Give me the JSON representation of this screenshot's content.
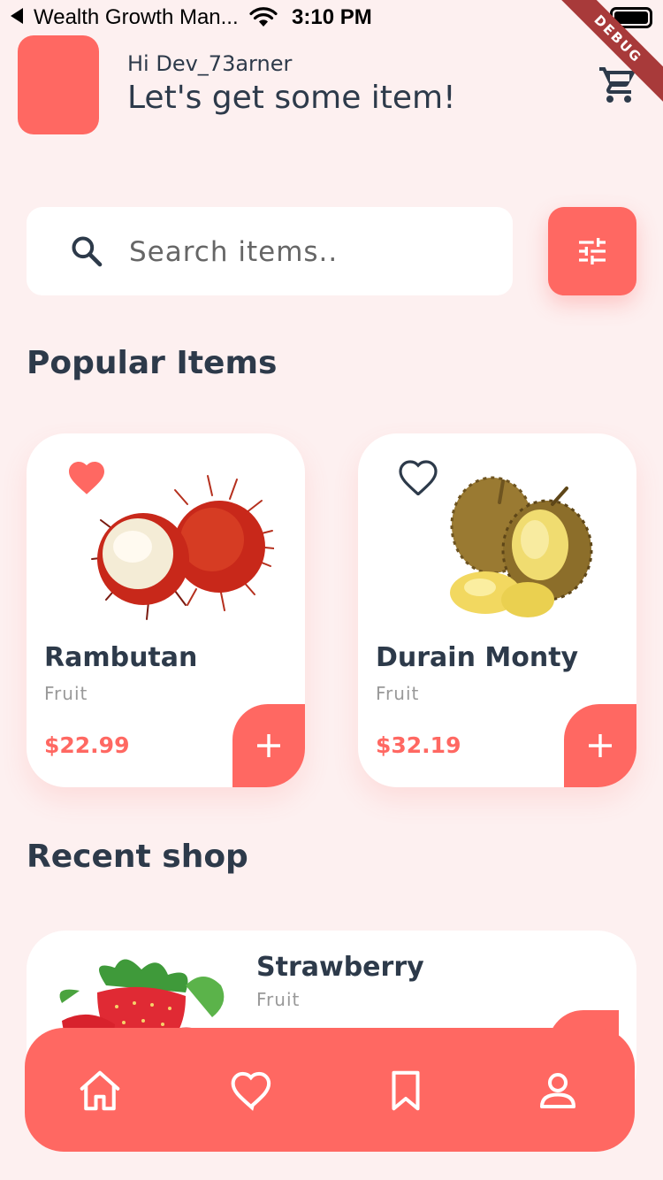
{
  "status_bar": {
    "app_name": "Wealth Growth Man...",
    "time": "3:10 PM"
  },
  "debug_ribbon": "DEBUG",
  "header": {
    "greeting": "Hi Dev_73arner",
    "headline": "Let's get some item!",
    "cart_icon": "cart-icon"
  },
  "search": {
    "placeholder": "Search items..",
    "value": "",
    "filter_icon": "tune-icon"
  },
  "popular": {
    "title": "Popular Items",
    "items": [
      {
        "name": "Rambutan",
        "category": "Fruit",
        "price": "$22.99",
        "favorite": true,
        "image": "rambutan-image"
      },
      {
        "name": "Durain Monty",
        "category": "Fruit",
        "price": "$32.19",
        "favorite": false,
        "image": "durian-image"
      }
    ]
  },
  "recent": {
    "title": "Recent shop",
    "items": [
      {
        "name": "Strawberry",
        "category": "Fruit",
        "image": "strawberry-image"
      }
    ]
  },
  "bottom_nav": {
    "items": [
      "home-icon",
      "heart-icon",
      "bookmark-icon",
      "profile-icon"
    ]
  },
  "colors": {
    "accent": "#ff6862",
    "background": "#fdf0f0",
    "text": "#2d3a4a",
    "muted": "#999999"
  }
}
